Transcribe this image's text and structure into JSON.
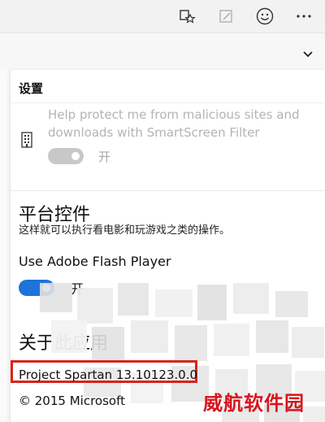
{
  "toolbar": {
    "icons": [
      "reading-list-icon",
      "web-note-icon",
      "feedback-smiley-icon",
      "more-icon"
    ]
  },
  "settings": {
    "title": "设置",
    "smartscreen": {
      "text": "Help protect me from malicious sites and downloads with SmartScreen Filter",
      "toggle_state": "开"
    },
    "platform": {
      "heading": "平台控件",
      "description": "这样就可以执行看电影和玩游戏之类的操作。",
      "flash_label": "Use Adobe Flash Player",
      "flash_toggle_state": "开"
    },
    "about": {
      "heading": "关于此应用",
      "version": "Project Spartan 13.10123.0.0",
      "copyright": "© 2015 Microsoft"
    }
  },
  "watermark": "威航软件园",
  "colors": {
    "accent": "#1d73d8",
    "highlight": "#d9231c",
    "watermark": "#d8141e"
  }
}
